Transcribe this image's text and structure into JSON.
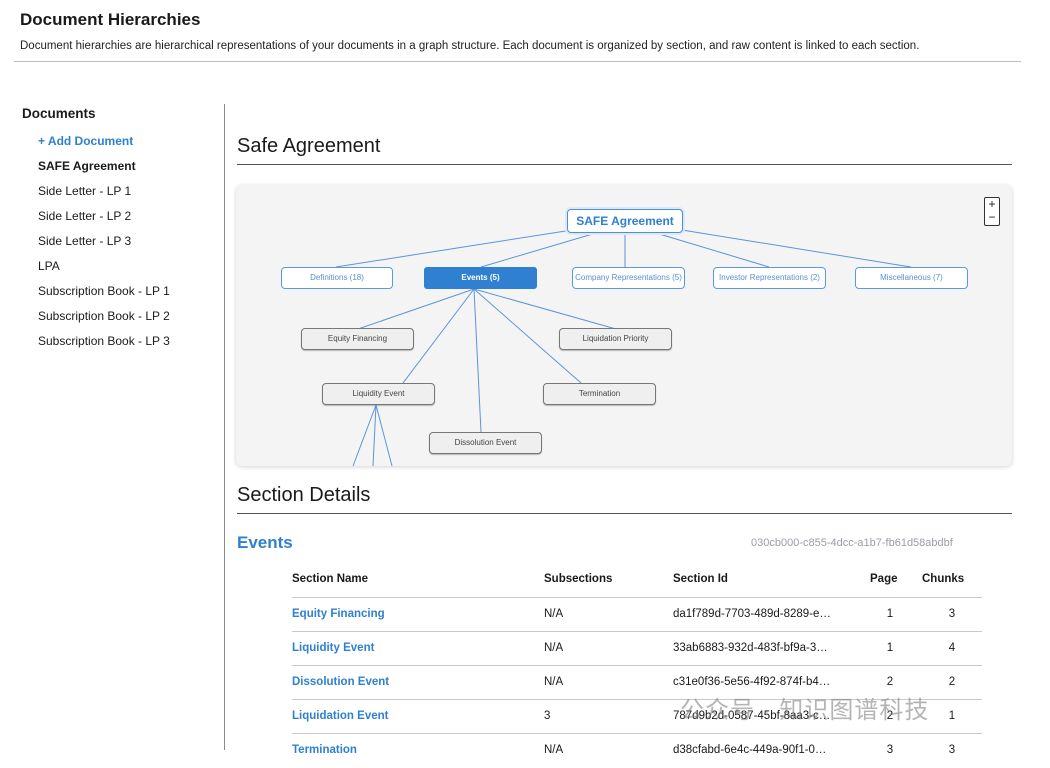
{
  "header": {
    "title": "Document Hierarchies",
    "description": "Document hierarchies are hierarchical representations of your documents in a graph structure. Each document is organized by section, and raw content is linked to each section."
  },
  "sidebar": {
    "title": "Documents",
    "add_label": "+ Add Document",
    "items": [
      {
        "label": "SAFE Agreement",
        "active": true
      },
      {
        "label": "Side Letter - LP 1"
      },
      {
        "label": "Side Letter - LP 2"
      },
      {
        "label": "Side Letter - LP 3"
      },
      {
        "label": "LPA"
      },
      {
        "label": "Subscription Book - LP 1"
      },
      {
        "label": "Subscription Book - LP 2"
      },
      {
        "label": "Subscription Book - LP 3"
      }
    ]
  },
  "main": {
    "title": "Safe Agreement",
    "zoom_in": "+",
    "zoom_out": "−"
  },
  "graph": {
    "root": "SAFE Agreement",
    "sections": [
      "Definitions (18)",
      "Events (5)",
      "Company Representations (5)",
      "Investor Representations (2)",
      "Miscellaneous (7)"
    ],
    "event_children": [
      "Equity Financing",
      "Liquidation Priority",
      "Liquidity Event",
      "Termination",
      "Dissolution Event"
    ]
  },
  "details": {
    "title": "Section Details",
    "section_name": "Events",
    "section_id": "030cb000-c855-4dcc-a1b7-fb61d58abdbf",
    "columns": [
      "Section Name",
      "Subsections",
      "Section Id",
      "Page",
      "Chunks"
    ],
    "rows": [
      {
        "name": "Equity Financing",
        "subsections": "N/A",
        "id": "da1f789d-7703-489d-8289-e…",
        "page": "1",
        "chunks": "3"
      },
      {
        "name": "Liquidity Event",
        "subsections": "N/A",
        "id": "33ab6883-932d-483f-bf9a-3…",
        "page": "1",
        "chunks": "4"
      },
      {
        "name": "Dissolution Event",
        "subsections": "N/A",
        "id": "c31e0f36-5e56-4f92-874f-b4…",
        "page": "2",
        "chunks": "2"
      },
      {
        "name": "Liquidation Event",
        "subsections": "3",
        "id": "787d9b2d-0587-45bf-8aa3-c…",
        "page": "2",
        "chunks": "1"
      },
      {
        "name": "Termination",
        "subsections": "N/A",
        "id": "d38cfabd-6e4c-449a-90f1-0…",
        "page": "3",
        "chunks": "3"
      }
    ]
  },
  "watermark": "公众号 · 知识图谱科技"
}
